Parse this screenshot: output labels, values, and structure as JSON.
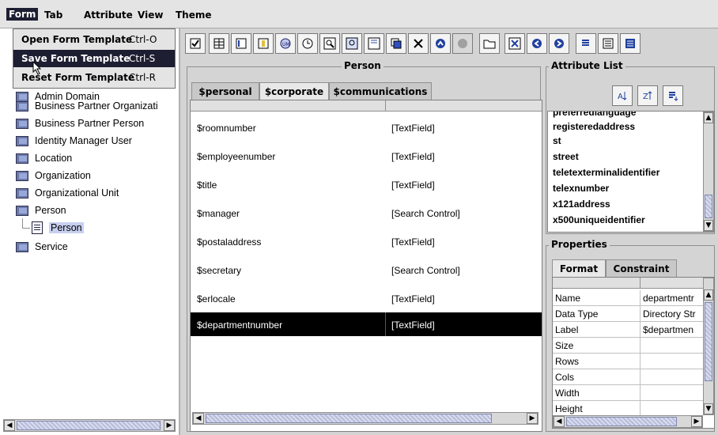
{
  "menubar": {
    "items": [
      "Form",
      "Tab",
      "Attribute",
      "View",
      "Theme"
    ]
  },
  "form_menu": {
    "items": [
      {
        "label": "Open Form Template",
        "shortcut": "Ctrl-O"
      },
      {
        "label": "Save Form Template",
        "shortcut": "Ctrl-S"
      },
      {
        "label": "Reset Form Template",
        "shortcut": "Ctrl-R"
      }
    ]
  },
  "tree": {
    "items": [
      "Admin Domain",
      "Business Partner Organizati",
      "Business Partner Person",
      "Identity Manager User",
      "Location",
      "Organization",
      "Organizational Unit",
      "Person",
      "Person",
      "Service"
    ]
  },
  "editor": {
    "title": "Person",
    "tabs": [
      "$personal",
      "$corporate",
      "$communications"
    ],
    "active_tab": 1,
    "rows": [
      {
        "attr": "$roomnumber",
        "control": "[TextField]"
      },
      {
        "attr": "$employeenumber",
        "control": "[TextField]"
      },
      {
        "attr": "$title",
        "control": "[TextField]"
      },
      {
        "attr": "$manager",
        "control": "[Search Control]"
      },
      {
        "attr": "$postaladdress",
        "control": "[TextField]"
      },
      {
        "attr": "$secretary",
        "control": "[Search Control]"
      },
      {
        "attr": "$erlocale",
        "control": "[TextField]"
      },
      {
        "attr": "$departmentnumber",
        "control": "[TextField]"
      }
    ],
    "selected_row": 7
  },
  "attribute_list": {
    "title": "Attribute List",
    "items": [
      "preferredlanguage",
      "registeredaddress",
      "st",
      "street",
      "teletexterminalidentifier",
      "telexnumber",
      "x121address",
      "x500uniqueidentifier"
    ]
  },
  "properties": {
    "title": "Properties",
    "tabs": [
      "Format",
      "Constraint"
    ],
    "rows": [
      {
        "key": "Name",
        "value": "departmentr"
      },
      {
        "key": "Data Type",
        "value": "Directory Str"
      },
      {
        "key": "Label",
        "value": "$departmen"
      },
      {
        "key": "Size",
        "value": ""
      },
      {
        "key": "Rows",
        "value": ""
      },
      {
        "key": "Cols",
        "value": ""
      },
      {
        "key": "Width",
        "value": ""
      },
      {
        "key": "Height",
        "value": ""
      }
    ]
  },
  "colors": {
    "selection": "#000000",
    "menu_highlight": "#1e1e32",
    "panel": "#d4d4d4"
  }
}
